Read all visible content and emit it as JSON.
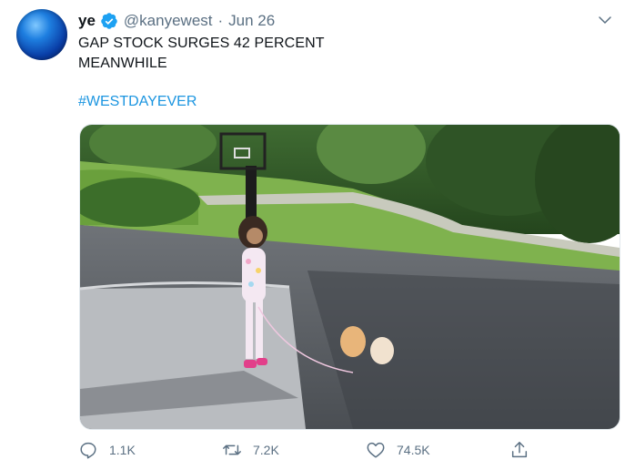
{
  "tweet": {
    "author_name": "ye",
    "handle": "@kanyewest",
    "separator": "·",
    "date": "Jun 26",
    "verified": true,
    "text_lines": [
      "GAP STOCK SURGES 42 PERCENT",
      "MEANWHILE"
    ],
    "hashtag": "#WESTDAYEVER"
  },
  "actions": {
    "reply_count": "1.1K",
    "retweet_count": "7.2K",
    "like_count": "74.5K"
  },
  "colors": {
    "accent": "#1b95e0",
    "muted": "#5b7083",
    "text": "#0f1419"
  },
  "icons": {
    "avatar": "blue-sphere-avatar",
    "verified": "verified-badge-icon",
    "menu": "chevron-down-icon",
    "reply": "reply-icon",
    "retweet": "retweet-icon",
    "like": "heart-icon",
    "share": "share-icon"
  }
}
